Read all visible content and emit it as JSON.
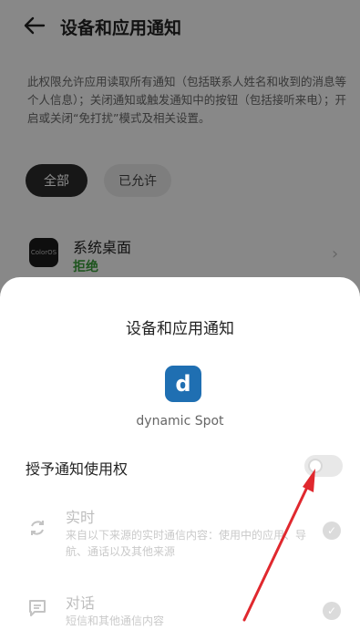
{
  "header": {
    "title": "设备和应用通知"
  },
  "description": "此权限允许应用读取所有通知（包括联系人姓名和收到的消息等个人信息）；关闭通知或触发通知中的按钮（包括接听来电）；开启或关闭“免打扰”模式及相关设置。",
  "filters": {
    "all_label": "全部",
    "allowed_label": "已允许"
  },
  "app_row": {
    "icon_text": "ColorOS",
    "name": "系统桌面",
    "status": "拒绝"
  },
  "sheet": {
    "title": "设备和应用通知",
    "app_icon_letter": "d",
    "app_name": "dynamic Spot",
    "grant_label": "授予通知使用权",
    "options": [
      {
        "title": "实时",
        "subtitle": "来自以下来源的实时通信内容：使用中的应用、导航、通话以及其他来源"
      },
      {
        "title": "对话",
        "subtitle": "短信和其他通信内容"
      }
    ]
  },
  "colors": {
    "status_denied": "#3a9b3a",
    "app_icon_bg": "#1f6fb2",
    "annotation_arrow": "#e0282e"
  }
}
